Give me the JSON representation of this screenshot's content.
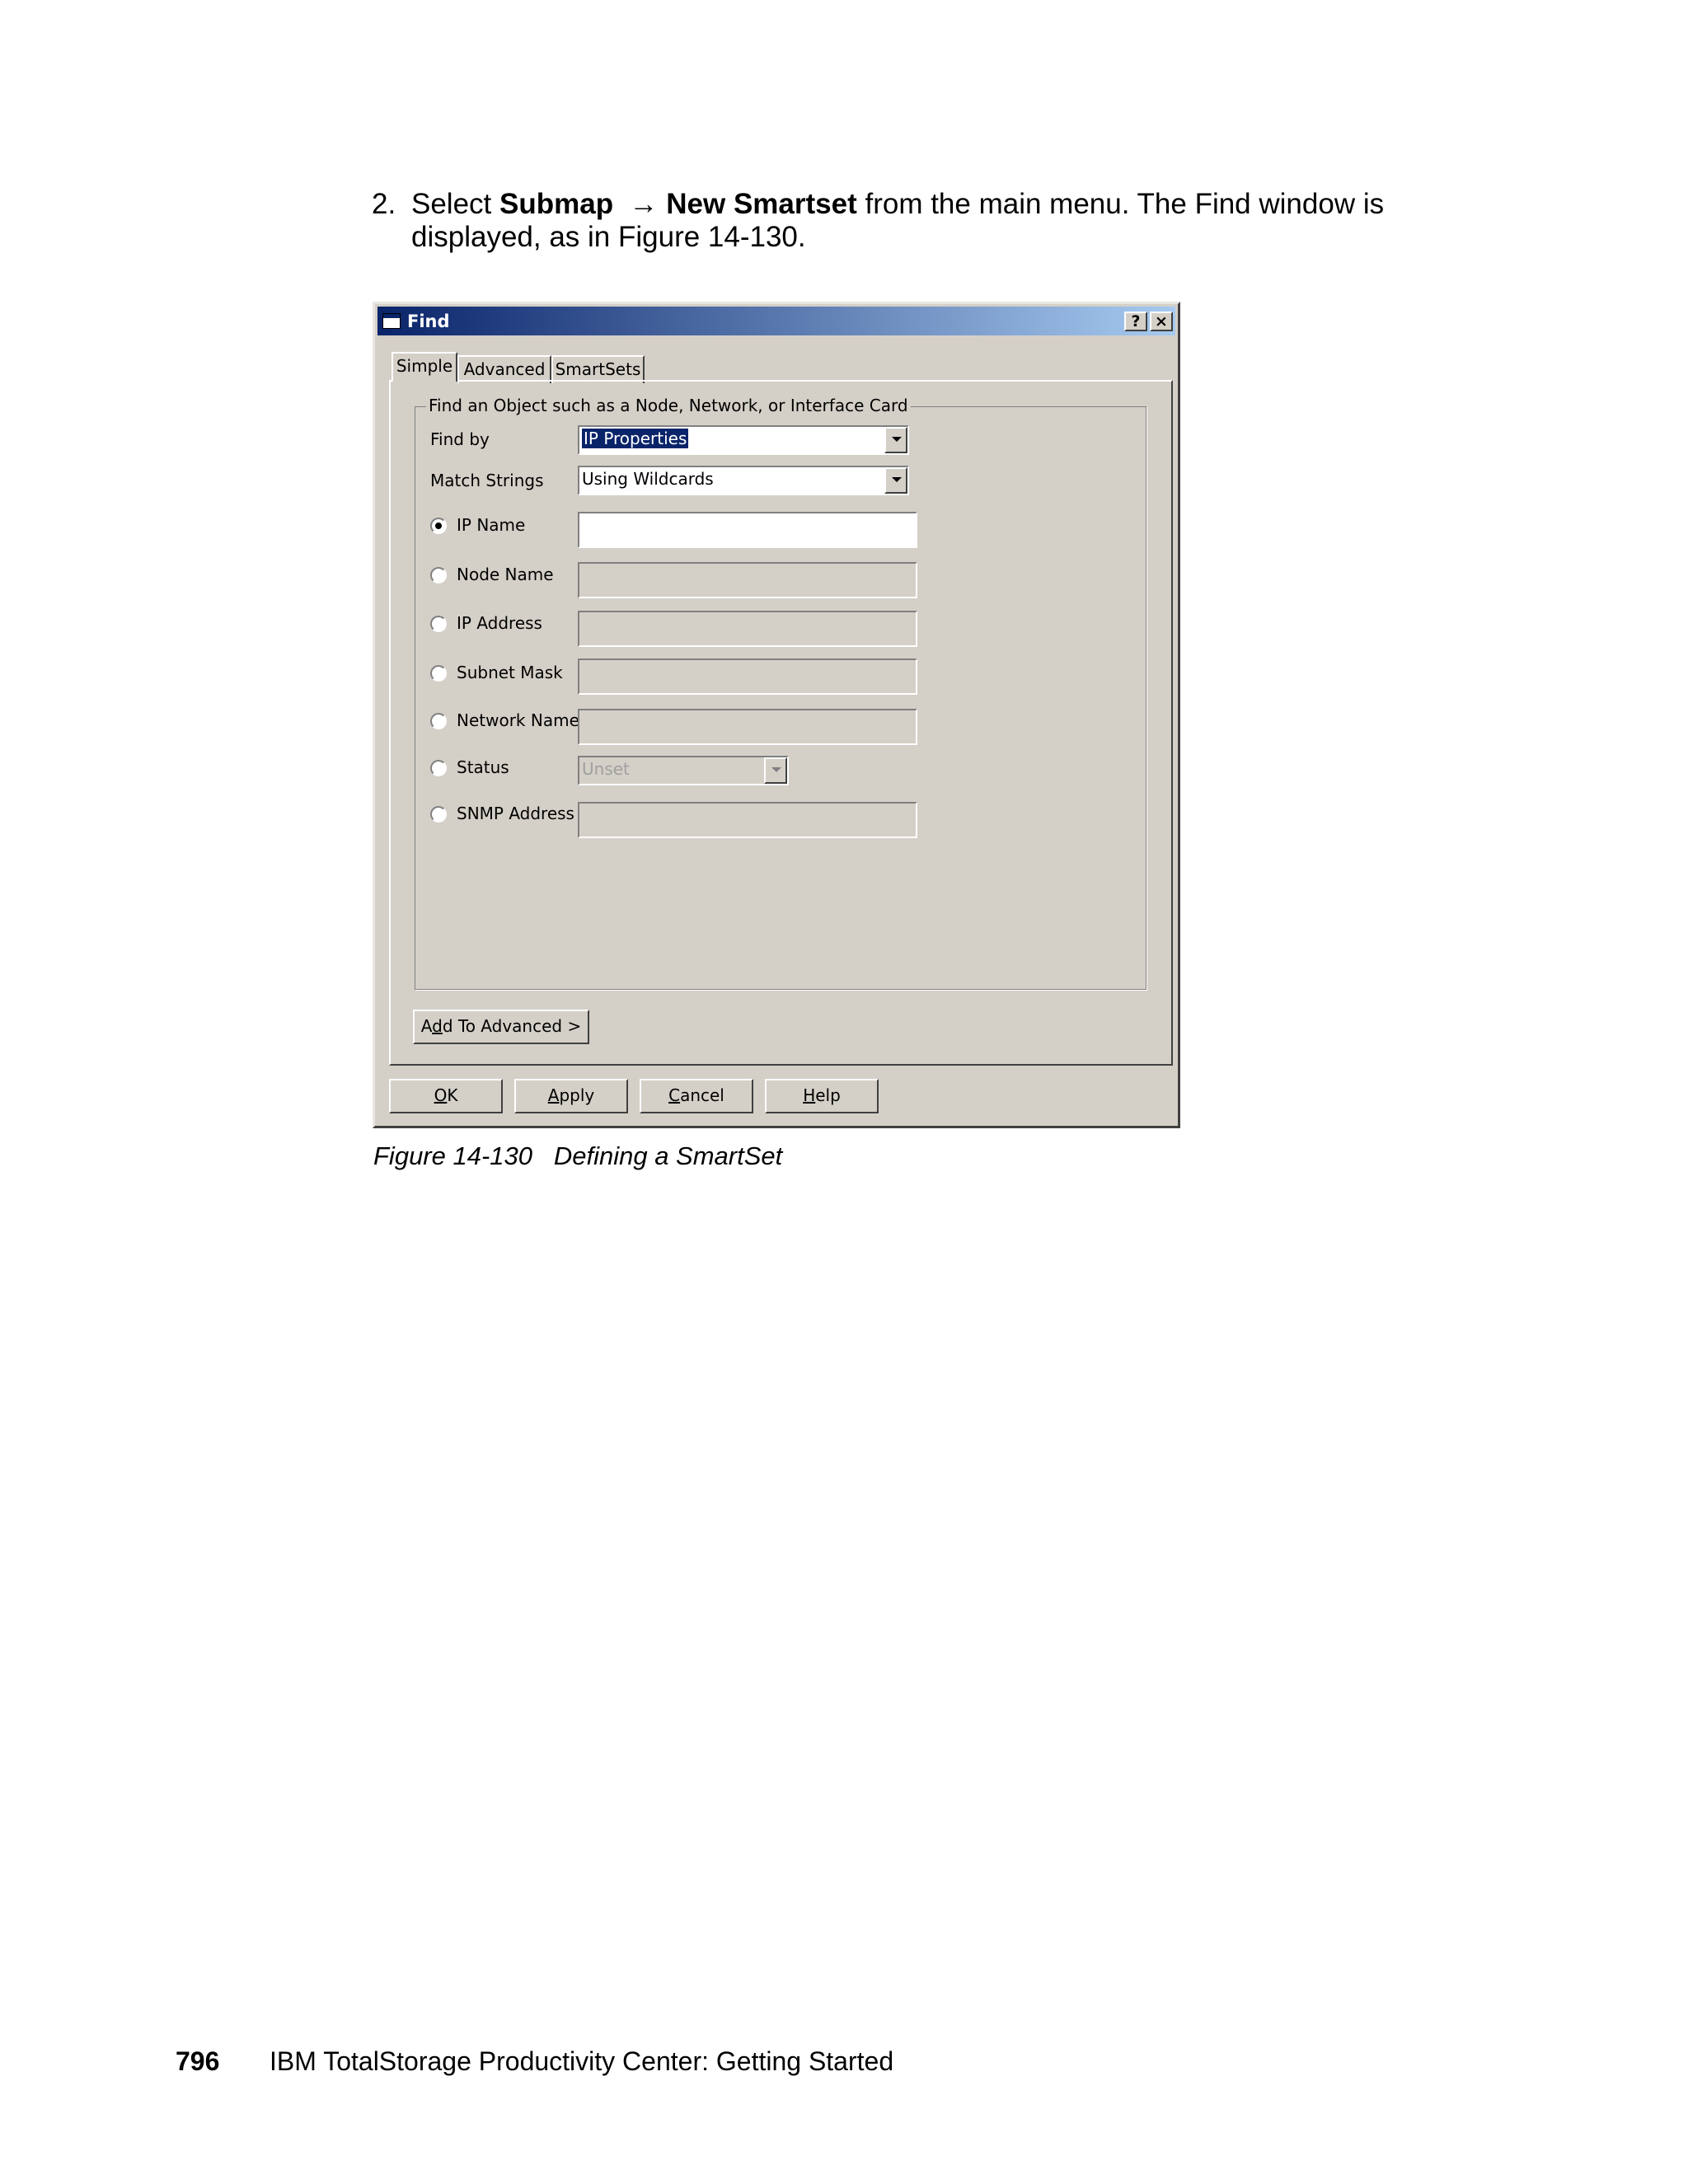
{
  "step": {
    "number": "2.",
    "prefix": "Select ",
    "menu_item_1": "Submap",
    "arrow": "→",
    "menu_item_2": "New Smartset",
    "suffix": " from the main menu. The Find window is displayed, as in Figure 14-130."
  },
  "dialog": {
    "title": "Find",
    "help_button": "?",
    "close_button": "×",
    "tabs": [
      "Simple",
      "Advanced",
      "SmartSets"
    ],
    "active_tab": "Simple",
    "group_label": "Find an Object such as a Node, Network, or Interface Card",
    "find_by": {
      "label": "Find by",
      "value": "IP Properties"
    },
    "match_strings": {
      "label": "Match Strings",
      "value": "Using Wildcards"
    },
    "options": [
      {
        "label": "IP Name",
        "checked": true
      },
      {
        "label": "Node Name",
        "checked": false
      },
      {
        "label": "IP Address",
        "checked": false
      },
      {
        "label": "Subnet Mask",
        "checked": false
      },
      {
        "label": "Network Name",
        "checked": false
      },
      {
        "label": "Status",
        "checked": false,
        "value": "Unset"
      },
      {
        "label": "SNMP Address",
        "checked": false
      }
    ],
    "add_to_advanced": {
      "mnemonic": "d",
      "before": "A",
      "after": "d To Advanced >"
    },
    "buttons": {
      "ok": {
        "mnemonic": "O",
        "rest": "K"
      },
      "apply": {
        "mnemonic": "A",
        "rest": "pply"
      },
      "cancel": {
        "mnemonic": "C",
        "rest": "ancel"
      },
      "help": {
        "mnemonic": "H",
        "rest": "elp"
      }
    }
  },
  "caption": "Figure 14-130   Defining a SmartSet",
  "footer": {
    "page_number": "796",
    "book_title": "IBM TotalStorage Productivity Center: Getting Started"
  }
}
